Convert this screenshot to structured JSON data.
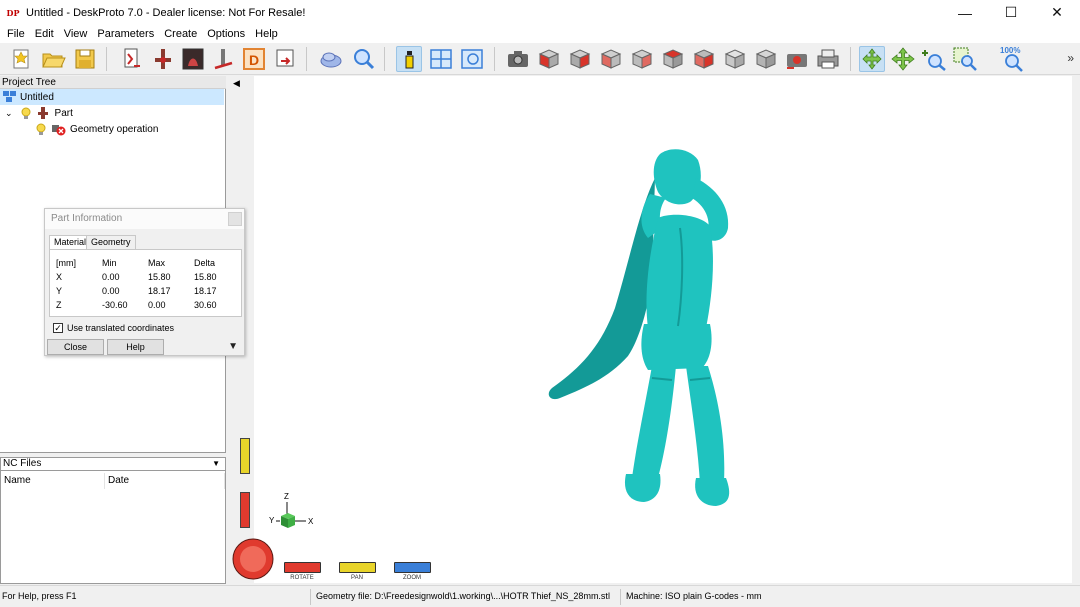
{
  "window": {
    "icon_text": "DP",
    "title": "Untitled - DeskProto 7.0 - Dealer license: Not For Resale!",
    "minimize": "—",
    "maximize": "☐",
    "close": "✕"
  },
  "menu": [
    "File",
    "Edit",
    "View",
    "Parameters",
    "Create",
    "Options",
    "Help"
  ],
  "toolbar": {
    "zoom_percent_label": "100%",
    "more": "»",
    "buttons": [
      "new-project-icon",
      "open-project-icon",
      "save-project-icon",
      "load-part-icon",
      "part-position-icon",
      "part-image-icon",
      "machine-icon",
      "drawing-icon",
      "export-icon",
      "shaded-view-icon",
      "zoom-part-icon",
      "information-icon",
      "layout-icon",
      "toolpath-view-icon",
      "camera-icon",
      "view-front-icon",
      "view-back-icon",
      "view-left-icon",
      "view-right-icon",
      "view-top-icon",
      "view-bottom-icon",
      "view-iso-icon",
      "view-iso2-icon",
      "screenshot-icon",
      "print-icon",
      "rotate-mode-icon",
      "pan-mode-icon",
      "zoom-mode-icon",
      "zoom-window-icon",
      "zoom-100-icon"
    ]
  },
  "project_tree": {
    "title": "Project Tree",
    "root": "Untitled",
    "part": "Part",
    "operation": "Geometry operation"
  },
  "nc_files": {
    "title": "NC Files",
    "columns": [
      "Name",
      "Date"
    ]
  },
  "part_info": {
    "title": "Part Information",
    "tabs": [
      "Material",
      "Geometry"
    ],
    "headers": [
      "[mm]",
      "Min",
      "Max",
      "Delta"
    ],
    "rows": [
      {
        "axis": "X",
        "min": "0.00",
        "max": "15.80",
        "delta": "15.80"
      },
      {
        "axis": "Y",
        "min": "0.00",
        "max": "18.17",
        "delta": "18.17"
      },
      {
        "axis": "Z",
        "min": "-30.60",
        "max": "0.00",
        "delta": "30.60"
      }
    ],
    "checkbox_label": "Use translated coordinates",
    "checkbox_checked": "✓",
    "close_label": "Close",
    "help_label": "Help",
    "more_arrow": "▼"
  },
  "viewport": {
    "collapse_arrow": "◀",
    "axis_z": "Z",
    "axis_y": "Y",
    "axis_x": "X",
    "model_color": "#1fc3bf",
    "modes": [
      {
        "label": "ROTATE",
        "color": "#e03a2e"
      },
      {
        "label": "PAN",
        "color": "#e8d42a"
      },
      {
        "label": "ZOOM",
        "color": "#3a7fd8"
      }
    ]
  },
  "status": {
    "help": "For Help, press F1",
    "geometry_file": "Geometry file: D:\\Freedesignwold\\1.working\\...\\HOTR Thief_NS_28mm.stl",
    "machine": "Machine: ISO plain G-codes - mm"
  }
}
